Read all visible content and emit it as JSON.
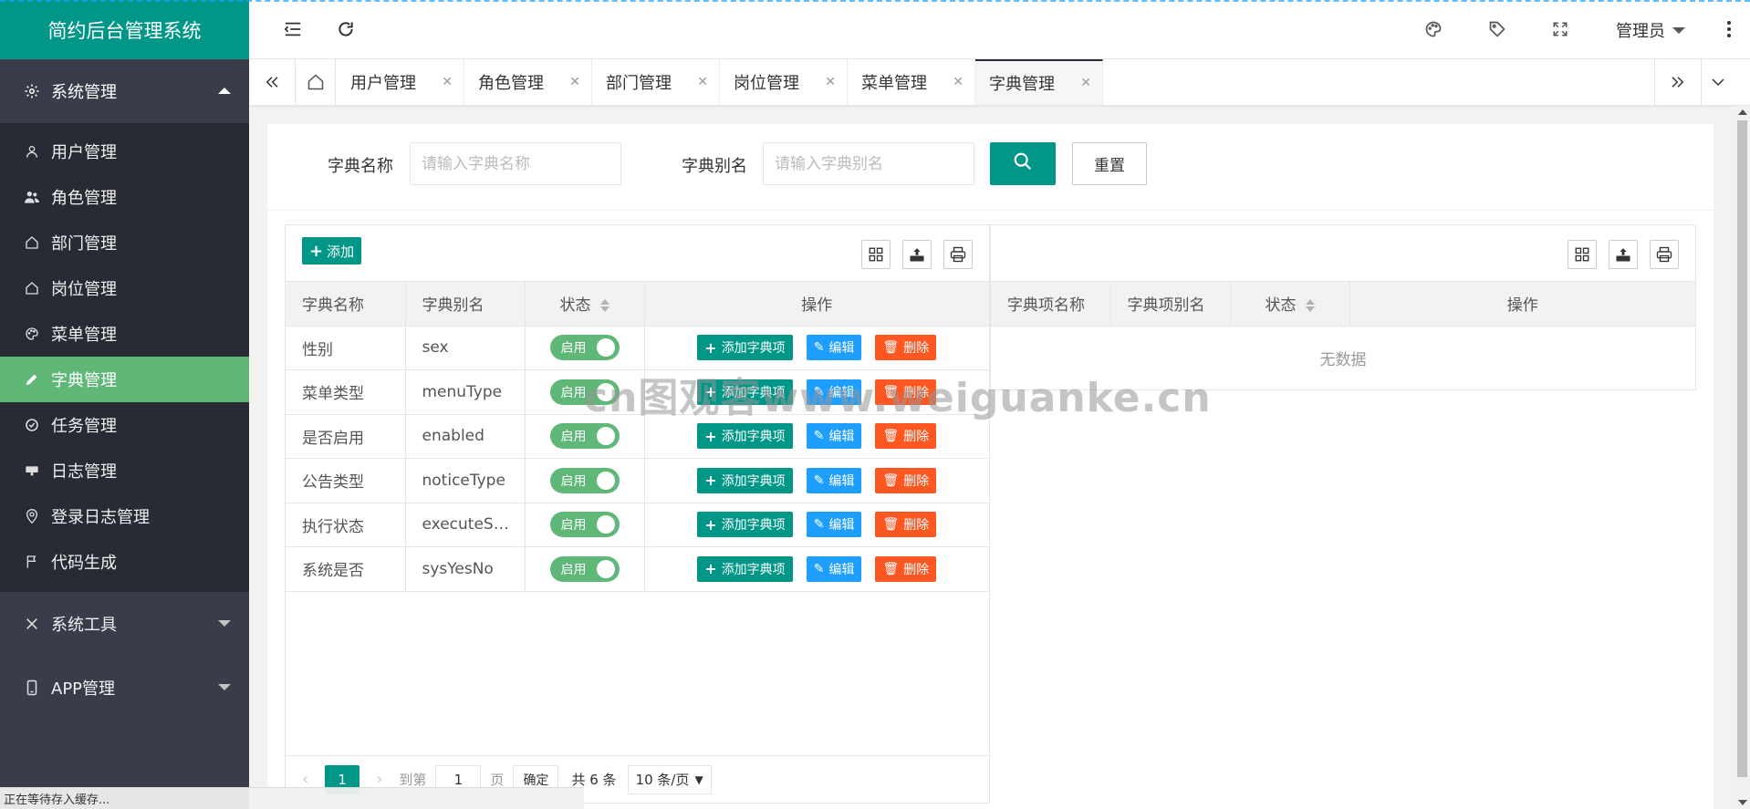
{
  "app": {
    "title": "简约后台管理系统"
  },
  "sidebar": {
    "parent_system": "系统管理",
    "items": [
      {
        "label": "用户管理",
        "icon": "user-icon"
      },
      {
        "label": "角色管理",
        "icon": "users-icon"
      },
      {
        "label": "部门管理",
        "icon": "home-icon"
      },
      {
        "label": "岗位管理",
        "icon": "home-icon"
      },
      {
        "label": "菜单管理",
        "icon": "palette-icon"
      },
      {
        "label": "字典管理",
        "icon": "pencil-icon",
        "active": true
      },
      {
        "label": "任务管理",
        "icon": "check-circle-icon"
      },
      {
        "label": "日志管理",
        "icon": "message-icon"
      },
      {
        "label": "登录日志管理",
        "icon": "location-icon"
      },
      {
        "label": "代码生成",
        "icon": "flag-icon"
      }
    ],
    "parent_tools": "系统工具",
    "parent_app": "APP管理"
  },
  "header": {
    "user": "管理员"
  },
  "tabs": [
    {
      "label": "用户管理"
    },
    {
      "label": "角色管理"
    },
    {
      "label": "部门管理"
    },
    {
      "label": "岗位管理"
    },
    {
      "label": "菜单管理"
    },
    {
      "label": "字典管理",
      "active": true
    }
  ],
  "search": {
    "name_label": "字典名称",
    "name_placeholder": "请输入字典名称",
    "alias_label": "字典别名",
    "alias_placeholder": "请输入字典别名",
    "reset_label": "重置"
  },
  "left_table": {
    "add_label": "添加",
    "columns": [
      "字典名称",
      "字典别名",
      "状态",
      "操作"
    ],
    "rows": [
      {
        "name": "性别",
        "alias": "sex",
        "status": "启用"
      },
      {
        "name": "菜单类型",
        "alias": "menuType",
        "status": "启用"
      },
      {
        "name": "是否启用",
        "alias": "enabled",
        "status": "启用"
      },
      {
        "name": "公告类型",
        "alias": "noticeType",
        "status": "启用"
      },
      {
        "name": "执行状态",
        "alias": "executeS…",
        "status": "启用"
      },
      {
        "name": "系统是否",
        "alias": "sysYesNo",
        "status": "启用"
      }
    ],
    "actions": {
      "add_item": "添加字典项",
      "edit": "编辑",
      "delete": "删除"
    }
  },
  "right_table": {
    "columns": [
      "字典项名称",
      "字典项别名",
      "状态",
      "操作"
    ],
    "empty": "无数据"
  },
  "pager": {
    "current": "1",
    "goto_label": "到第",
    "goto_value": "1",
    "page_unit": "页",
    "confirm": "确定",
    "total": "共 6 条",
    "page_size": "10 条/页"
  },
  "statusbar": {
    "text": "正在等待存入缓存..."
  },
  "watermark": "cn图观客www.weiguanke.cn",
  "colors": {
    "primary": "#009688",
    "sidebar": "#393d49",
    "active": "#5fb878",
    "blue": "#1e9fff",
    "red": "#ff5722"
  }
}
